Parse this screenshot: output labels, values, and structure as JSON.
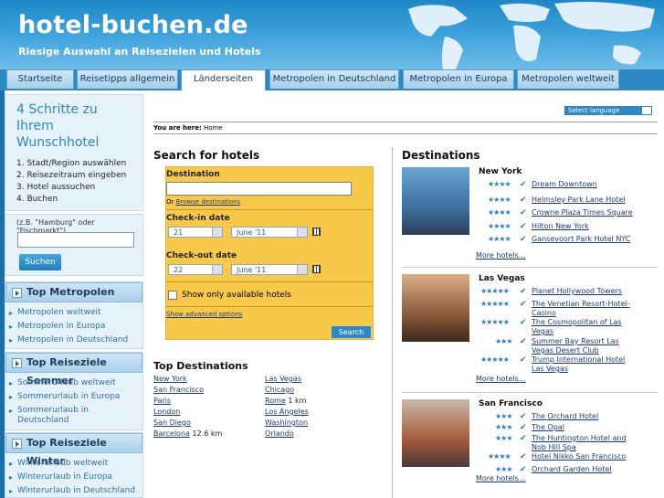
{
  "header": {
    "title": "hotel-buchen.de",
    "subtitle": "Riesige Auswahl an Reisezielen und Hotels"
  },
  "tabs": [
    {
      "label": "Startseite"
    },
    {
      "label": "Reisetipps allgemein"
    },
    {
      "label": "Länderseiten",
      "active": true
    },
    {
      "label": "Metropolen in Deutschland"
    },
    {
      "label": "Metropolen in Europa"
    },
    {
      "label": "Metropolen weltweit"
    }
  ],
  "sidebar": {
    "steps_title": "4 Schritte zu Ihrem Wunschhotel",
    "steps": [
      "1. Stadt/Region auswählen",
      "2. Reisezeitraum eingeben",
      "3. Hotel aussuchen",
      "4. Buchen"
    ],
    "search_hint": "(z.B. \"Hamburg\" oder \"Fischmarkt\")",
    "search_value": "",
    "search_button": "Suchen",
    "sections": [
      {
        "title": "Top Metropolen",
        "links": [
          "Metropolen weltweit",
          "Metropolen in Europa",
          "Metropolen in Deutschland"
        ]
      },
      {
        "title": "Top Reiseziele Sommer",
        "links": [
          "Sommerurlaub weltweit",
          "Sommerurlaub in Europa",
          "Sommerurlaub in Deutschland"
        ]
      },
      {
        "title": "Top Reiseziele Winter",
        "links": [
          "Winterurlaub weltweit",
          "Winterurlaub in Europa",
          "Winterurlaub in Deutschland"
        ]
      }
    ]
  },
  "main": {
    "language_select": "Select language",
    "breadcrumb": {
      "prefix": "You are here:",
      "current": "Home"
    },
    "search": {
      "heading": "Search for hotels",
      "destination_label": "Destination",
      "destination_value": "",
      "or_text": "Or",
      "browse_link": "Browse destinations",
      "checkin_label": "Check-in date",
      "checkin_day": "21",
      "checkin_month": "June '11",
      "checkout_label": "Check-out date",
      "checkout_day": "22",
      "checkout_month": "June '11",
      "available_label": "Show only available hotels",
      "available_checked": false,
      "advanced_link": "Show advanced options",
      "search_button": "Search"
    },
    "top_destinations": {
      "heading": "Top Destinations",
      "left": [
        {
          "name": "New York",
          "extra": ""
        },
        {
          "name": "San Francisco",
          "extra": ""
        },
        {
          "name": "Paris",
          "extra": ""
        },
        {
          "name": "London",
          "extra": ""
        },
        {
          "name": "San Diego",
          "extra": ""
        },
        {
          "name": "Barcelona",
          "extra": "12.6 km"
        }
      ],
      "right": [
        {
          "name": "Las Vegas",
          "extra": ""
        },
        {
          "name": "Chicago",
          "extra": ""
        },
        {
          "name": "Rome",
          "extra": "1 km"
        },
        {
          "name": "Los Angeles",
          "extra": ""
        },
        {
          "name": "Washington",
          "extra": ""
        },
        {
          "name": "Orlando",
          "extra": ""
        }
      ]
    },
    "destinations": {
      "heading": "Destinations",
      "more_label": "More hotels...",
      "cities": [
        {
          "city": "New York",
          "hotels": [
            {
              "name": "Dream Downtown",
              "stars": 4
            },
            {
              "name": "Helmsley Park Lane Hotel",
              "stars": 4
            },
            {
              "name": "Crowne Plaza Times Square",
              "stars": 4
            },
            {
              "name": "Hilton New York",
              "stars": 4
            },
            {
              "name": "Gansevoort Park Hotel NYC",
              "stars": 4
            }
          ]
        },
        {
          "city": "Las Vegas",
          "hotels": [
            {
              "name": "Planet Hollywood Towers",
              "stars": 5
            },
            {
              "name": "The Venetian Resort-Hotel-Casino",
              "stars": 5
            },
            {
              "name": "The Cosmopolitan of Las Vegas",
              "stars": 5
            },
            {
              "name": "Summer Bay Resort Las Vegas Desert Club",
              "stars": 3
            },
            {
              "name": "Trump International Hotel Las Vegas",
              "stars": 5
            }
          ]
        },
        {
          "city": "San Francisco",
          "hotels": [
            {
              "name": "The Orchard Hotel",
              "stars": 3
            },
            {
              "name": "The Opal",
              "stars": 3
            },
            {
              "name": "The Huntington Hotel and Nob Hill Spa",
              "stars": 3
            },
            {
              "name": "Hotel Nikko San Francisco",
              "stars": 4
            },
            {
              "name": "Orchard Garden Hotel",
              "stars": 3
            }
          ]
        }
      ]
    }
  },
  "colors": {
    "accent": "#2a86c6",
    "search_box": "#f8c949",
    "header": "#1f87c6"
  }
}
